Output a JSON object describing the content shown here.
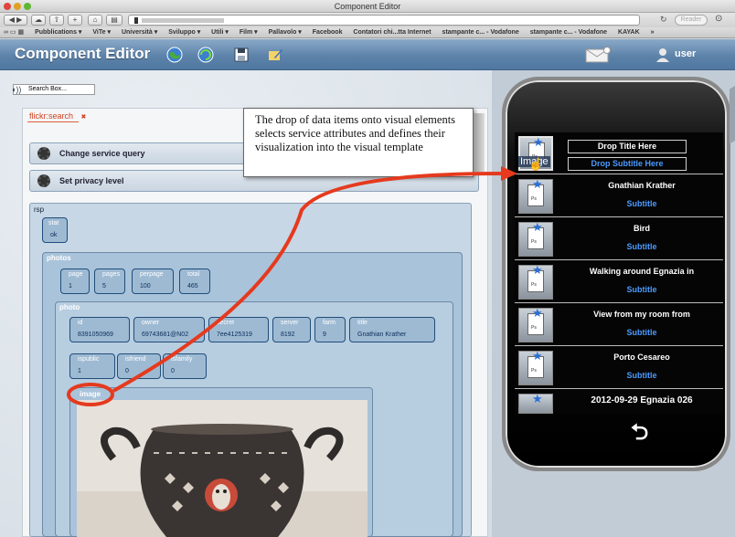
{
  "window": {
    "title": "Component Editor"
  },
  "browser": {
    "reader": "Reader",
    "bookmarks": [
      "Pubblications ▾",
      "ViTe ▾",
      "Università ▾",
      "Sviluppo ▾",
      "Utili ▾",
      "Film ▾",
      "Pallavolo ▾",
      "Facebook",
      "Contatori chi...tta Internet",
      "stampante c... - Vodafone",
      "stampante c... - Vodafone",
      "KAYAK",
      "»"
    ]
  },
  "app": {
    "title": "Component Editor",
    "user": "user"
  },
  "search": {
    "placeholder": "Search Box..."
  },
  "tab": {
    "label": "flickr:search",
    "close": "✖"
  },
  "bars": {
    "change_query": "Change service query",
    "privacy": "Set privacy level"
  },
  "tree": {
    "rsp": "rsp",
    "stat": {
      "name": "stat",
      "value": "ok"
    },
    "photos": {
      "label": "photos",
      "fields": [
        {
          "name": "page",
          "value": "1"
        },
        {
          "name": "pages",
          "value": "5"
        },
        {
          "name": "perpage",
          "value": "100"
        },
        {
          "name": "total",
          "value": "465"
        }
      ]
    },
    "photo": {
      "label": "photo",
      "fields": [
        {
          "name": "id",
          "value": "8391050969"
        },
        {
          "name": "owner",
          "value": "69743681@N02"
        },
        {
          "name": "secret",
          "value": "7ee4125319"
        },
        {
          "name": "server",
          "value": "8192"
        },
        {
          "name": "farm",
          "value": "9"
        },
        {
          "name": "title",
          "value": "Gnathian Krather"
        }
      ],
      "fields2": [
        {
          "name": "ispublic",
          "value": "1"
        },
        {
          "name": "isfriend",
          "value": "0"
        },
        {
          "name": "isfamily",
          "value": "0"
        }
      ]
    },
    "image": {
      "label": "image"
    }
  },
  "callout": {
    "text": "The drop of data items onto visual elements selects service attributes and defines their visualization into the visual template"
  },
  "phone": {
    "drag_label": "Image",
    "drop_title": "Drop Title Here",
    "drop_subtitle": "Drop Subtitle Here",
    "rows": [
      {
        "title": "Gnathian Krather",
        "subtitle": "Subtitle"
      },
      {
        "title": "Bird",
        "subtitle": "Subtitle"
      },
      {
        "title": "Walking around Egnazia in",
        "subtitle": "Subtitle"
      },
      {
        "title": "View from my room from",
        "subtitle": "Subtitle"
      },
      {
        "title": "Porto Cesareo",
        "subtitle": "Subtitle"
      },
      {
        "title": "2012-09-29 Egnazia 026",
        "subtitle": ""
      }
    ],
    "back_icon": "⮌",
    "thumb_text": "Ps"
  },
  "colors": {
    "accent": "#e53a1e",
    "header": "#5d83aa",
    "phone_link": "#4c9bff"
  }
}
